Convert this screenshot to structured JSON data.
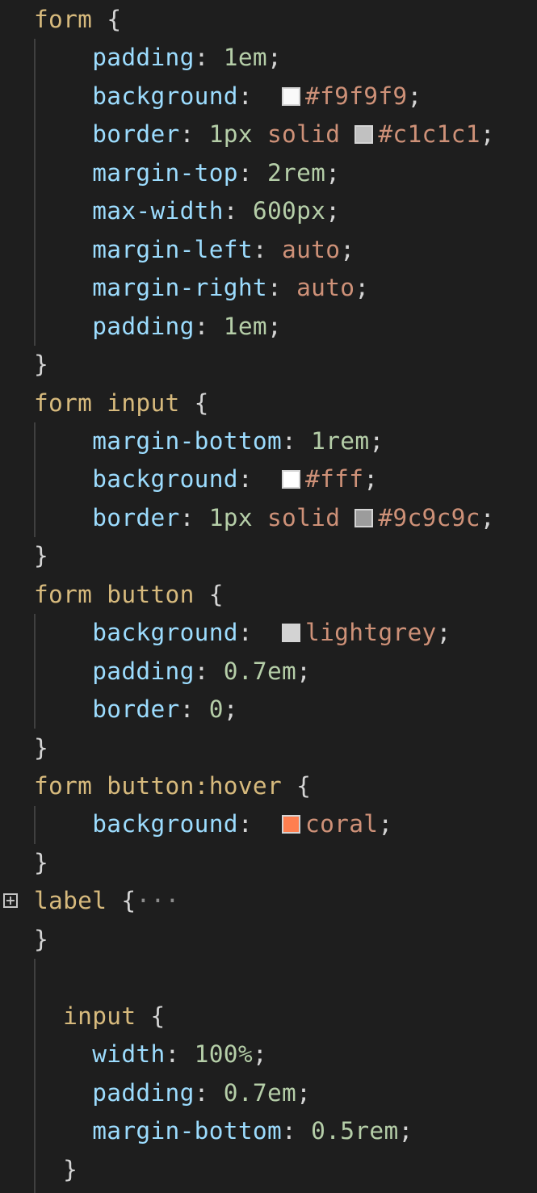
{
  "lines": [
    {
      "tokens": [
        {
          "t": "sel",
          "v": "form "
        },
        {
          "t": "punc",
          "v": "{"
        }
      ]
    },
    {
      "tokens": [
        {
          "t": "prop",
          "v": "    padding"
        },
        {
          "t": "punc",
          "v": ": "
        },
        {
          "t": "num",
          "v": "1em"
        },
        {
          "t": "punc",
          "v": ";"
        }
      ]
    },
    {
      "tokens": [
        {
          "t": "prop",
          "v": "    background"
        },
        {
          "t": "punc",
          "v": ":  "
        },
        {
          "t": "swatch",
          "color": "#f9f9f9"
        },
        {
          "t": "val",
          "v": "#f9f9f9"
        },
        {
          "t": "punc",
          "v": ";"
        }
      ]
    },
    {
      "tokens": [
        {
          "t": "prop",
          "v": "    border"
        },
        {
          "t": "punc",
          "v": ": "
        },
        {
          "t": "num",
          "v": "1px"
        },
        {
          "t": "punc",
          "v": " "
        },
        {
          "t": "val",
          "v": "solid"
        },
        {
          "t": "punc",
          "v": " "
        },
        {
          "t": "swatch",
          "color": "#c1c1c1"
        },
        {
          "t": "val",
          "v": "#c1c1c1"
        },
        {
          "t": "punc",
          "v": ";"
        }
      ]
    },
    {
      "tokens": [
        {
          "t": "prop",
          "v": "    margin-top"
        },
        {
          "t": "punc",
          "v": ": "
        },
        {
          "t": "num",
          "v": "2rem"
        },
        {
          "t": "punc",
          "v": ";"
        }
      ]
    },
    {
      "tokens": [
        {
          "t": "prop",
          "v": "    max-width"
        },
        {
          "t": "punc",
          "v": ": "
        },
        {
          "t": "num",
          "v": "600px"
        },
        {
          "t": "punc",
          "v": ";"
        }
      ]
    },
    {
      "tokens": [
        {
          "t": "prop",
          "v": "    margin-left"
        },
        {
          "t": "punc",
          "v": ": "
        },
        {
          "t": "val",
          "v": "auto"
        },
        {
          "t": "punc",
          "v": ";"
        }
      ]
    },
    {
      "tokens": [
        {
          "t": "prop",
          "v": "    margin-right"
        },
        {
          "t": "punc",
          "v": ": "
        },
        {
          "t": "val",
          "v": "auto"
        },
        {
          "t": "punc",
          "v": ";"
        }
      ]
    },
    {
      "tokens": [
        {
          "t": "prop",
          "v": "    padding"
        },
        {
          "t": "punc",
          "v": ": "
        },
        {
          "t": "num",
          "v": "1em"
        },
        {
          "t": "punc",
          "v": ";"
        }
      ]
    },
    {
      "tokens": [
        {
          "t": "punc",
          "v": "}"
        }
      ]
    },
    {
      "tokens": [
        {
          "t": "sel",
          "v": "form input "
        },
        {
          "t": "punc",
          "v": "{"
        }
      ]
    },
    {
      "tokens": [
        {
          "t": "prop",
          "v": "    margin-bottom"
        },
        {
          "t": "punc",
          "v": ": "
        },
        {
          "t": "num",
          "v": "1rem"
        },
        {
          "t": "punc",
          "v": ";"
        }
      ]
    },
    {
      "tokens": [
        {
          "t": "prop",
          "v": "    background"
        },
        {
          "t": "punc",
          "v": ":  "
        },
        {
          "t": "swatch",
          "color": "#ffffff"
        },
        {
          "t": "val",
          "v": "#fff"
        },
        {
          "t": "punc",
          "v": ";"
        }
      ]
    },
    {
      "tokens": [
        {
          "t": "prop",
          "v": "    border"
        },
        {
          "t": "punc",
          "v": ": "
        },
        {
          "t": "num",
          "v": "1px"
        },
        {
          "t": "punc",
          "v": " "
        },
        {
          "t": "val",
          "v": "solid"
        },
        {
          "t": "punc",
          "v": " "
        },
        {
          "t": "swatch",
          "color": "#9c9c9c"
        },
        {
          "t": "val",
          "v": "#9c9c9c"
        },
        {
          "t": "punc",
          "v": ";"
        }
      ]
    },
    {
      "tokens": [
        {
          "t": "punc",
          "v": "}"
        }
      ]
    },
    {
      "tokens": [
        {
          "t": "sel",
          "v": "form button "
        },
        {
          "t": "punc",
          "v": "{"
        }
      ]
    },
    {
      "tokens": [
        {
          "t": "prop",
          "v": "    background"
        },
        {
          "t": "punc",
          "v": ":  "
        },
        {
          "t": "swatch",
          "color": "#d3d3d3"
        },
        {
          "t": "val",
          "v": "lightgrey"
        },
        {
          "t": "punc",
          "v": ";"
        }
      ]
    },
    {
      "tokens": [
        {
          "t": "prop",
          "v": "    padding"
        },
        {
          "t": "punc",
          "v": ": "
        },
        {
          "t": "num",
          "v": "0.7em"
        },
        {
          "t": "punc",
          "v": ";"
        }
      ]
    },
    {
      "tokens": [
        {
          "t": "prop",
          "v": "    border"
        },
        {
          "t": "punc",
          "v": ": "
        },
        {
          "t": "num",
          "v": "0"
        },
        {
          "t": "punc",
          "v": ";"
        }
      ]
    },
    {
      "tokens": [
        {
          "t": "punc",
          "v": "}"
        }
      ]
    },
    {
      "tokens": [
        {
          "t": "sel",
          "v": "form button:hover "
        },
        {
          "t": "punc",
          "v": "{"
        }
      ]
    },
    {
      "tokens": [
        {
          "t": "prop",
          "v": "    background"
        },
        {
          "t": "punc",
          "v": ":  "
        },
        {
          "t": "swatch",
          "color": "#ff7f50"
        },
        {
          "t": "val",
          "v": "coral"
        },
        {
          "t": "punc",
          "v": ";"
        }
      ]
    },
    {
      "tokens": [
        {
          "t": "punc",
          "v": "}"
        }
      ]
    },
    {
      "tokens": [
        {
          "t": "sel",
          "v": "label "
        },
        {
          "t": "punc",
          "v": "{"
        },
        {
          "t": "ell",
          "v": "···"
        }
      ],
      "folded": true
    },
    {
      "tokens": [
        {
          "t": "punc",
          "v": "}"
        }
      ]
    },
    {
      "tokens": []
    },
    {
      "tokens": [
        {
          "t": "sel",
          "v": "  input "
        },
        {
          "t": "punc",
          "v": "{"
        }
      ]
    },
    {
      "tokens": [
        {
          "t": "prop",
          "v": "    width"
        },
        {
          "t": "punc",
          "v": ": "
        },
        {
          "t": "num",
          "v": "100%"
        },
        {
          "t": "punc",
          "v": ";"
        }
      ]
    },
    {
      "tokens": [
        {
          "t": "prop",
          "v": "    padding"
        },
        {
          "t": "punc",
          "v": ": "
        },
        {
          "t": "num",
          "v": "0.7em"
        },
        {
          "t": "punc",
          "v": ";"
        }
      ]
    },
    {
      "tokens": [
        {
          "t": "prop",
          "v": "    margin-bottom"
        },
        {
          "t": "punc",
          "v": ": "
        },
        {
          "t": "num",
          "v": "0.5rem"
        },
        {
          "t": "punc",
          "v": ";"
        }
      ]
    },
    {
      "tokens": [
        {
          "t": "punc",
          "v": "  }"
        }
      ]
    }
  ],
  "theme": {
    "background": "#1e1e1e",
    "selector": "#d7ba7d",
    "property": "#9cdcfe",
    "number": "#b5cea8",
    "value": "#ce9178",
    "punctuation": "#d4d4d4"
  },
  "fold_icon": "plus-square-icon"
}
